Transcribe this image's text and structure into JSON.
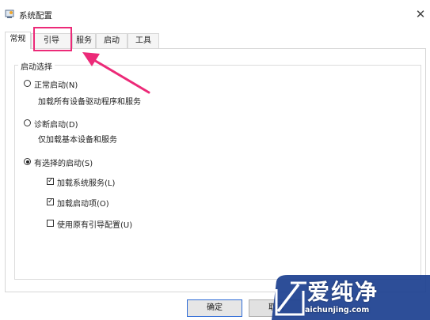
{
  "window": {
    "title": "系统配置",
    "close_glyph": "✕"
  },
  "tabs": [
    {
      "label": "常规",
      "selected": true
    },
    {
      "label": "引导",
      "highlighted": true
    },
    {
      "label": "服务"
    },
    {
      "label": "启动"
    },
    {
      "label": "工具"
    }
  ],
  "startup_selection": {
    "group_label": "启动选择",
    "options": [
      {
        "label": "正常启动(N)",
        "description": "加载所有设备驱动程序和服务",
        "selected": false
      },
      {
        "label": "诊断启动(D)",
        "description": "仅加载基本设备和服务",
        "selected": false
      },
      {
        "label": "有选择的启动(S)",
        "selected": true
      }
    ],
    "checkboxes": [
      {
        "label": "加载系统服务(L)",
        "checked": true
      },
      {
        "label": "加载启动项(O)",
        "checked": true
      },
      {
        "label": "使用原有引导配置(U)",
        "checked": false
      }
    ]
  },
  "buttons": {
    "ok": "确定",
    "cancel": "取消"
  },
  "watermark": {
    "brand": "爱纯净",
    "url": "aichunjing.com"
  },
  "colors": {
    "highlight": "#ec2a78",
    "ok_border": "#2d6bd6",
    "watermark_bg": "#1b3f8f"
  },
  "icons": {
    "app": "system-config-icon",
    "close": "close-icon",
    "annotation": "pink-arrow"
  }
}
